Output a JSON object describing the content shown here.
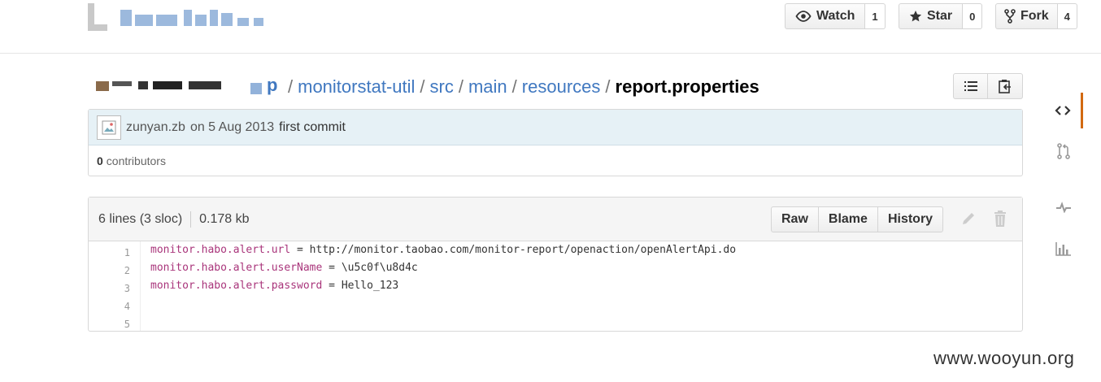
{
  "header": {
    "watch": {
      "label": "Watch",
      "count": "1"
    },
    "star": {
      "label": "Star",
      "count": "0"
    },
    "fork": {
      "label": "Fork",
      "count": "4"
    }
  },
  "breadcrumb": {
    "repo_tail": "p",
    "parts": [
      "monitorstat-util",
      "src",
      "main",
      "resources"
    ],
    "file": "report.properties",
    "separator": "/"
  },
  "commit": {
    "author": "zunyan.zb",
    "date": "on 5 Aug 2013",
    "message": "first commit"
  },
  "contributors": {
    "count": "0",
    "label": "contributors"
  },
  "file": {
    "lines": "6 lines (3 sloc)",
    "size": "0.178 kb",
    "actions": [
      "Raw",
      "Blame",
      "History"
    ]
  },
  "code": {
    "line_numbers": [
      "1",
      "2",
      "3",
      "4",
      "5"
    ],
    "lines": [
      {
        "key": "monitor.habo.alert.url",
        "value": "http://monitor.taobao.com/monitor-report/openaction/openAlertApi.do"
      },
      {
        "key": "monitor.habo.alert.userName",
        "value": "\\u5c0f\\u8d4c"
      },
      {
        "key": "monitor.habo.alert.password",
        "value": "Hello_123"
      },
      {
        "key": "",
        "value": ""
      },
      {
        "key": "",
        "value": ""
      }
    ]
  },
  "sidebar": [
    "code-icon",
    "pull-request-icon",
    "pulse-icon",
    "graph-icon"
  ],
  "watermark": "www.wooyun.org",
  "colors": {
    "link": "#4078c0",
    "key": "#a9357b",
    "active_tab": "#d26911"
  }
}
